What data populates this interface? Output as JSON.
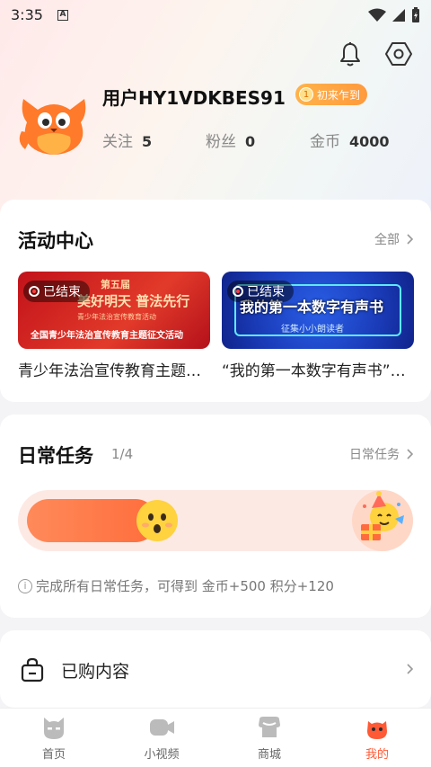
{
  "status_bar": {
    "time": "3:35",
    "notification_letter": "A"
  },
  "profile": {
    "username": "用户HY1VDKBES91",
    "level_badge": {
      "level": "1",
      "text": "初来乍到"
    },
    "stats": [
      {
        "label": "关注",
        "value": "5"
      },
      {
        "label": "粉丝",
        "value": "0"
      },
      {
        "label": "金币",
        "value": "4000"
      }
    ]
  },
  "activity": {
    "title": "活动中心",
    "more_label": "全部",
    "banners": [
      {
        "status": "已结束",
        "image_text_top": "第五届",
        "image_text_main": "美好明天 普法先行",
        "image_text_sub": "青少年法治宣传教育活动",
        "image_text_bottom": "全国青少年法治宣传教育主题征文活动",
        "caption": "青少年法治宣传教育主题征文活动"
      },
      {
        "status": "已结束",
        "image_text_main": "我的第一本数字有声书",
        "image_text_sub": "征集小小朗读者",
        "caption": "“我的第一本数字有声书”征集小小朗读者"
      }
    ]
  },
  "tasks": {
    "title": "日常任务",
    "progress_text": "1/4",
    "progress_fraction": 0.25,
    "more_label": "日常任务",
    "note": "完成所有日常任务，可得到 金币+500 积分+120"
  },
  "purchased": {
    "label": "已购内容"
  },
  "tabbar": {
    "active_color": "#ff5a36",
    "items": [
      {
        "label": "首页",
        "icon": "cat-face-icon"
      },
      {
        "label": "小视频",
        "icon": "video-camera-icon"
      },
      {
        "label": "商城",
        "icon": "store-icon"
      },
      {
        "label": "我的",
        "icon": "mascot-icon"
      }
    ]
  }
}
